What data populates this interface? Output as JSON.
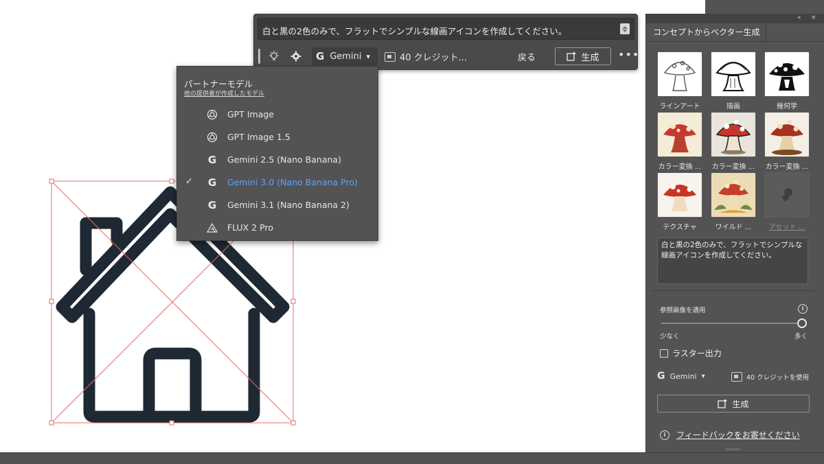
{
  "taskbar": {
    "prompt": "白と黒の2色のみで、フラットでシンプルな線画アイコンを作成してください。",
    "model_label": "Gemini",
    "model_glyph": "G",
    "credits_label": "40 クレジット...",
    "back_label": "戻る",
    "generate_label": "生成",
    "more_label": "•••"
  },
  "dropdown": {
    "heading": "パートナーモデル",
    "subheading": "他の提供者が作成したモデル",
    "check_glyph": "✓",
    "items": [
      {
        "label": "GPT Image",
        "icon": "openai-icon",
        "glyph": ""
      },
      {
        "label": "GPT Image 1.5",
        "icon": "openai-icon",
        "glyph": ""
      },
      {
        "label": "Gemini 2.5 (Nano Banana)",
        "icon": "google-icon",
        "glyph": "G"
      },
      {
        "label": "Gemini 3.0 (Nano Banana Pro)",
        "icon": "google-icon",
        "glyph": "G",
        "selected": true
      },
      {
        "label": "Gemini 3.1 (Nano Banana 2)",
        "icon": "google-icon",
        "glyph": "G"
      },
      {
        "label": "FLUX 2 Pro",
        "icon": "flux-icon",
        "glyph": ""
      }
    ],
    "selected_color": "#5aa2ff"
  },
  "panel": {
    "collapse_glyph": "«",
    "close_glyph": "×",
    "tab_label": "コンセプトからベクター生成",
    "styles": [
      {
        "label": "ラインアート"
      },
      {
        "label": "描画"
      },
      {
        "label": "幾何学"
      },
      {
        "label": "カラー変換 ..."
      },
      {
        "label": "カラー変換 ..."
      },
      {
        "label": "カラー変換 ..."
      },
      {
        "label": "テクスチャ"
      },
      {
        "label": "ワイルド ..."
      },
      {
        "label": "アセット ..."
      }
    ],
    "prompt": "白と黒の2色のみで、フラットでシンプルな線画アイコンを作成してください。",
    "reference_label": "参照画像を適用",
    "info_glyph": "i",
    "reference_strength": 1.0,
    "slider_min": "少なく",
    "slider_max": "多く",
    "raster_label": "ラスター出力",
    "model_label": "Gemini",
    "model_glyph": "G",
    "credits_label": "40 クレジットを使用",
    "generate_label": "生成",
    "feedback_label": "フィードバックをお寄せください"
  },
  "colors": {
    "selection": "#e76a6a",
    "icon_stroke": "#1f2933",
    "panel_bg": "#535353"
  }
}
